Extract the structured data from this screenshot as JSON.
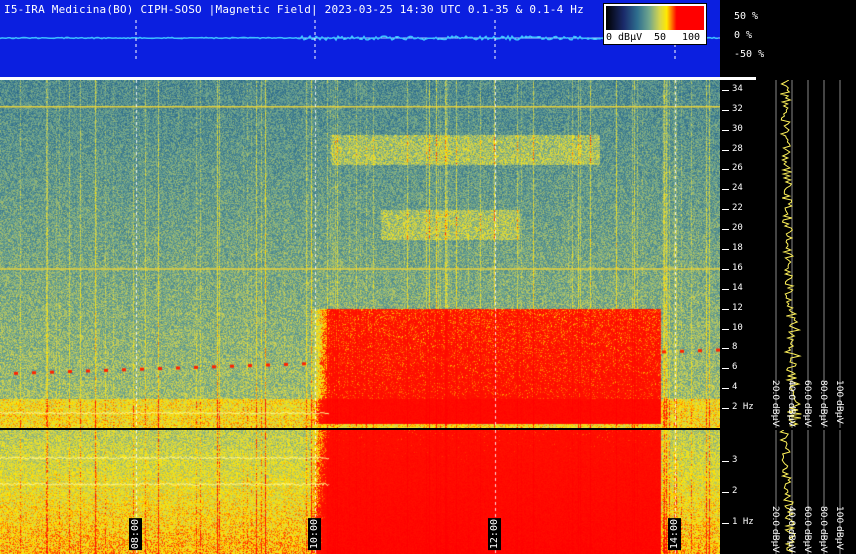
{
  "title": "I5-IRA Medicina(BO) CIPH-SOSO |Magnetic Field| 2023-03-25 14:30 UTC 0.1-35 & 0.1-4 Hz",
  "colorbar": {
    "labels": [
      "0 dBμV",
      "50",
      "100"
    ]
  },
  "amplitude_scale": [
    "50 %",
    "0 %",
    "-50 %"
  ],
  "colors": {
    "panel_blue": "#0b1fe0",
    "trace": "#3cc0ff",
    "grid_yellow": "#e8d23a",
    "hot": "#ff1a00"
  },
  "chart_data": [
    {
      "type": "heatmap",
      "title": "I5-IRA Medicina(BO) CIPH-SOSO |Magnetic Field| 2023-03-25 14:30 UTC 0.1-35 & 0.1-4 Hz",
      "x": {
        "label": "",
        "ticks": [
          "08:00",
          "10:00",
          "12:00",
          "14:00"
        ],
        "range_hours": [
          5.7,
          14.5
        ]
      },
      "y": {
        "label": "Hz",
        "range": [
          0.1,
          35
        ],
        "ticks": [
          2,
          4,
          6,
          8,
          10,
          12,
          14,
          16,
          18,
          20,
          22,
          24,
          26,
          28,
          30,
          32,
          34
        ]
      },
      "color_scale": {
        "unit": "dBμV",
        "range": [
          0,
          100
        ]
      }
    },
    {
      "type": "heatmap",
      "x": {
        "ticks": [
          "08:00",
          "10:00",
          "12:00",
          "14:00"
        ]
      },
      "y": {
        "label": "Hz",
        "range": [
          0.1,
          4
        ],
        "ticks": [
          1,
          2,
          3
        ]
      }
    },
    {
      "type": "line",
      "x_ticks": [
        "20.0 dBμV",
        "40.0 dBμV",
        "60.0 dBμV",
        "80.0 dBμV",
        "100 dBμV"
      ]
    }
  ],
  "freq_ticks_main": [
    "34",
    "32",
    "30",
    "28",
    "26",
    "24",
    "22",
    "20",
    "18",
    "16",
    "14",
    "12",
    "10",
    "8",
    "6",
    "4",
    "2 Hz"
  ],
  "freq_ticks_bottom": [
    "3",
    "2",
    "1 Hz"
  ],
  "db_ticks_main": [
    "20.0 dBμV",
    "40.0 dBμV",
    "60.0 dBμV",
    "80.0 dBμV",
    "100 dBμV"
  ],
  "db_ticks_bottom": [
    "20.0 dBμV",
    "40.0 dBμV",
    "60.0 dBμV",
    "80.0 dBμV",
    "100 dBμV"
  ],
  "time_ticks": [
    "08:00",
    "10:00",
    "12:00",
    "14:00"
  ]
}
